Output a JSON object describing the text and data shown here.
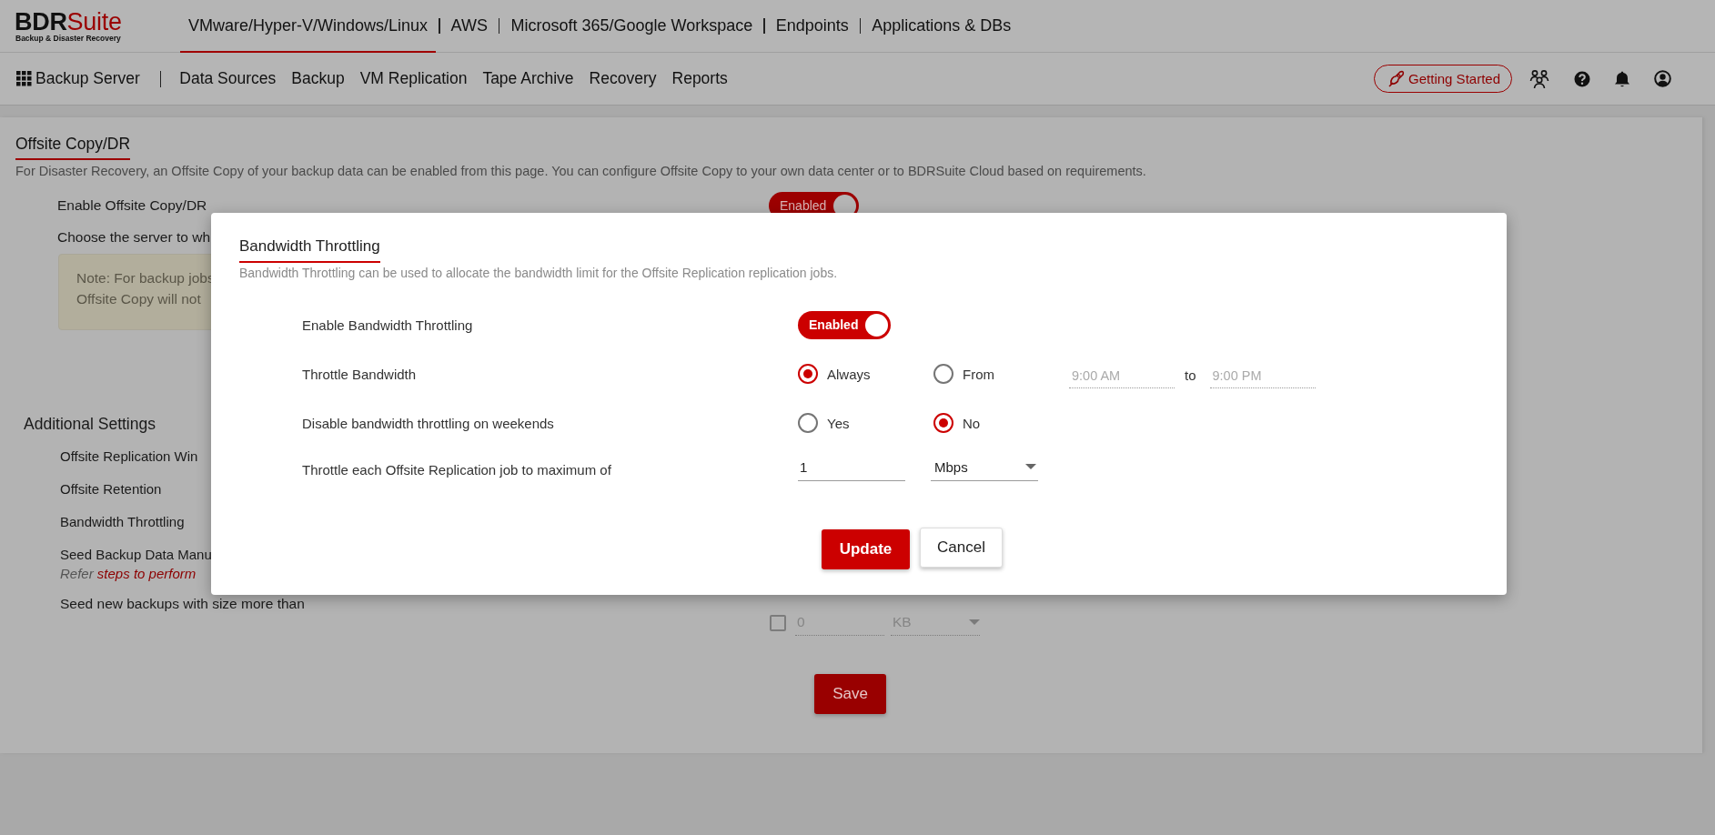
{
  "header": {
    "logo": {
      "name_main": "BDR",
      "name_accent": "Suite",
      "tagline": "Backup & Disaster Recovery"
    },
    "product_tabs": [
      {
        "label": "VMware/Hyper-V/Windows/Linux",
        "selected": true
      },
      {
        "label": "AWS",
        "selected": false
      },
      {
        "label": "Microsoft 365/Google Workspace",
        "selected": false
      },
      {
        "label": "Endpoints",
        "selected": false
      },
      {
        "label": "Applications & DBs",
        "selected": false
      }
    ]
  },
  "menu": {
    "apps_label": "Backup Server",
    "items": [
      "Data Sources",
      "Backup",
      "VM Replication",
      "Tape Archive",
      "Recovery",
      "Reports"
    ],
    "getting_started": "Getting Started"
  },
  "page": {
    "title": "Offsite Copy/DR",
    "description": "For Disaster Recovery, an Offsite Copy of your backup data can be enabled from this page. You can configure Offsite Copy to your own data center or to BDRSuite Cloud based on requirements.",
    "enable_offsite": {
      "label": "Enable Offsite Copy/DR",
      "text": "Enabled",
      "on": true
    },
    "choose_server_label": "Choose the server to wh",
    "note": [
      "Note: For backup jobs",
      "Offsite Copy will not"
    ],
    "additional_settings": {
      "title": "Additional Settings",
      "items": [
        "Offsite Replication Win",
        "Offsite Retention",
        "Bandwidth Throttling",
        "Seed Backup Data Manu"
      ]
    },
    "seed_refer": {
      "prefix": "Refer",
      "link": "steps to perform"
    },
    "seed_new": {
      "label": "Seed new backups with size more than",
      "checked": false,
      "value": "0",
      "unit": "KB"
    },
    "save": "Save"
  },
  "modal": {
    "title": "Bandwidth Throttling",
    "description": "Bandwidth Throttling can be used to allocate the bandwidth limit for the Offsite Replication replication jobs.",
    "rows": [
      {
        "kind": "toggle",
        "label": "Enable Bandwidth Throttling",
        "text": "Enabled",
        "on": true
      },
      {
        "kind": "radio",
        "label": "Throttle Bandwidth",
        "options": [
          {
            "label": "Always",
            "selected": true
          },
          {
            "label": "From",
            "selected": false
          }
        ],
        "time_from": {
          "value": "9:00 AM",
          "disabled": true
        },
        "to_label": "to",
        "time_to": {
          "value": "9:00 PM",
          "disabled": true
        }
      },
      {
        "kind": "radio",
        "label": "Disable bandwidth throttling on weekends",
        "options": [
          {
            "label": "Yes",
            "selected": false
          },
          {
            "label": "No",
            "selected": true
          }
        ]
      },
      {
        "kind": "limit",
        "label": "Throttle each Offsite Replication job to maximum of",
        "value": "1",
        "unit": "Mbps"
      }
    ],
    "buttons": [
      {
        "label": "Update",
        "kind": "primary"
      },
      {
        "label": "Cancel",
        "kind": "secondary"
      }
    ]
  }
}
